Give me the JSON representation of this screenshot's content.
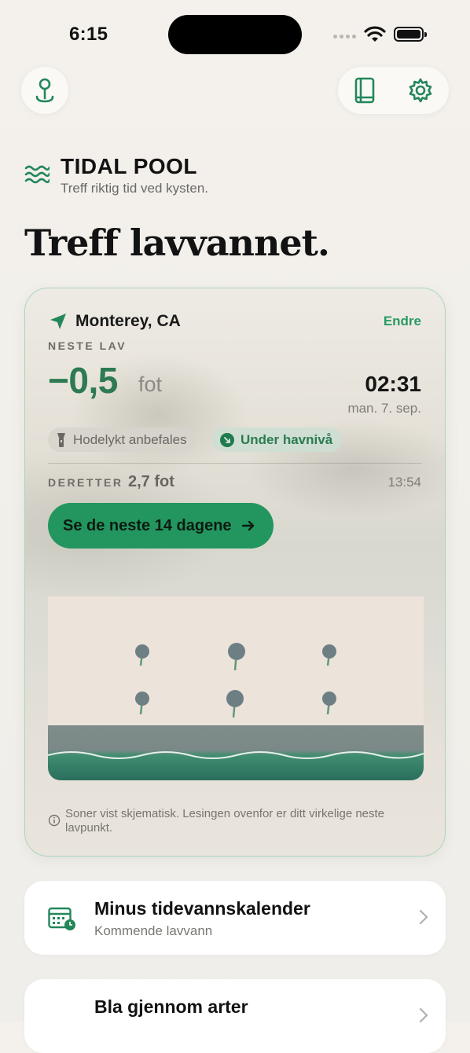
{
  "status": {
    "time": "6:15"
  },
  "header": {
    "brand": "TIDAL POOL",
    "tagline": "Treff riktig tid ved kysten.",
    "hero": "Treff lavvannet."
  },
  "card": {
    "location": "Monterey, CA",
    "edit_label": "Endre",
    "next_label": "NESTE LAV",
    "height_value": "−0,5",
    "height_unit": "fot",
    "low_time": "02:31",
    "low_date": "man. 7. sep.",
    "chip_headlamp": "Hodelykt anbefales",
    "chip_below": "Under havnivå",
    "then_label": "DERETTER",
    "then_value": "2,7 fot",
    "then_time": "13:54",
    "cta_label": "Se de neste 14 dagene",
    "note": "Soner vist skjematisk. Lesingen ovenfor er ditt virkelige neste lavpunkt."
  },
  "rows": [
    {
      "title": "Minus tidevannskalender",
      "subtitle": "Kommende lavvann"
    },
    {
      "title": "Bla gjennom arter",
      "subtitle": ""
    }
  ],
  "colors": {
    "accent": "#22965e",
    "accent_text": "#2d7a53"
  },
  "icons": [
    "location-pin-icon",
    "book-icon",
    "gear-icon",
    "waves-icon",
    "navigation-arrow-icon",
    "flashlight-icon",
    "arrow-down-right-icon",
    "arrow-right-icon",
    "info-icon",
    "calendar-icon",
    "chevron-right-icon",
    "species-icon"
  ]
}
